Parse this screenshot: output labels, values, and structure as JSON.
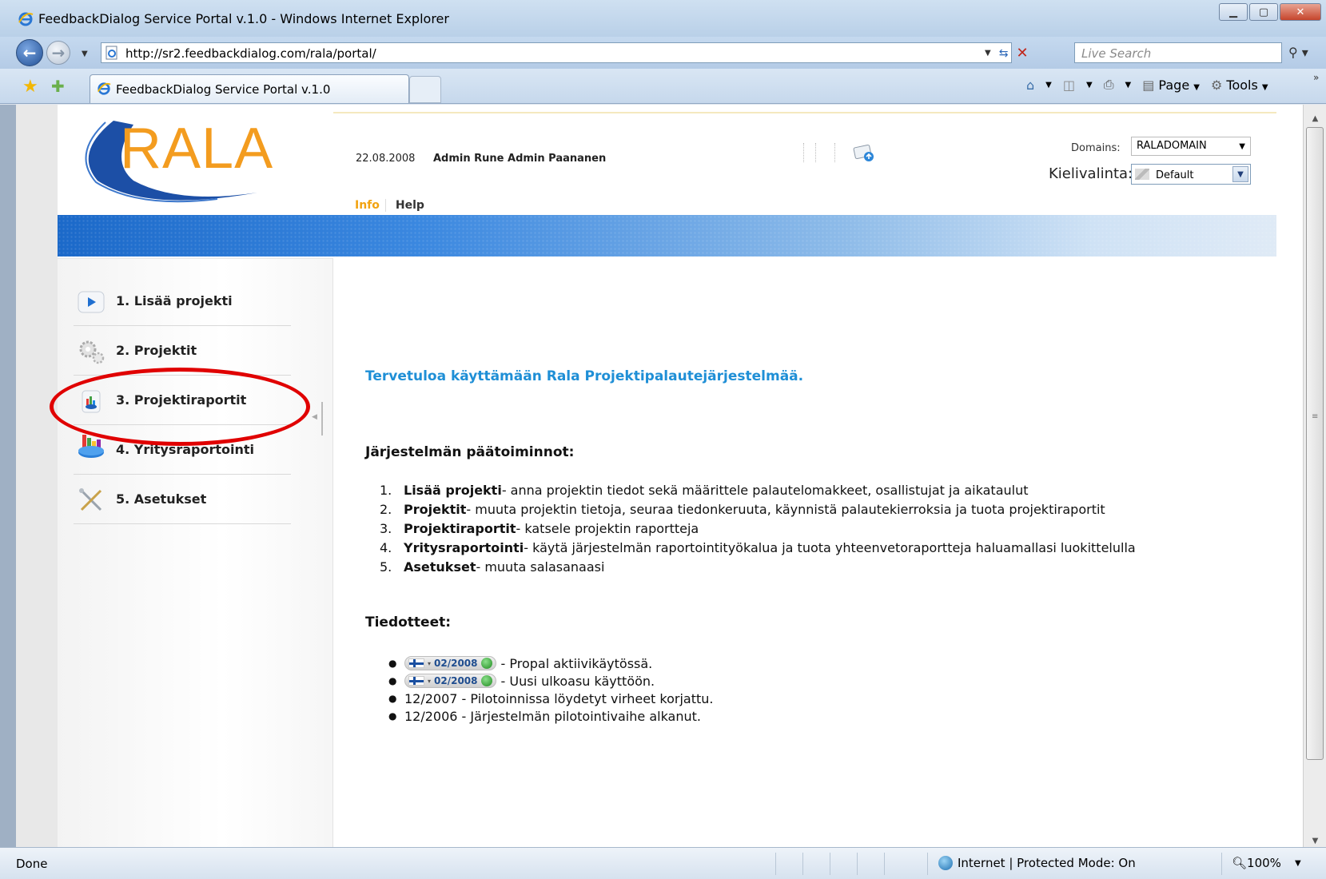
{
  "window": {
    "title": "FeedbackDialog Service Portal v.1.0 - Windows Internet Explorer",
    "url": "http://sr2.feedbackdialog.com/rala/portal/",
    "search_placeholder": "Live Search",
    "tab_title": "FeedbackDialog Service Portal v.1.0",
    "commands": {
      "page": "Page",
      "tools": "Tools"
    }
  },
  "header": {
    "logo_text": "RALA",
    "date": "22.08.2008",
    "user": "Admin Rune Admin Paananen",
    "domains_label": "Domains:",
    "domains_value": "RALADOMAIN",
    "language_label": "Kielivalinta:",
    "language_value": "Default",
    "nav": {
      "info": "Info",
      "help": "Help"
    }
  },
  "sidebar": {
    "items": [
      {
        "label": "1. Lisää projekti",
        "icon": "play-icon"
      },
      {
        "label": "2. Projektit",
        "icon": "gears-icon"
      },
      {
        "label": "3. Projektiraportit",
        "icon": "report-icon"
      },
      {
        "label": "4. Yritysraportointi",
        "icon": "chart-icon"
      },
      {
        "label": "5. Asetukset",
        "icon": "tools-icon"
      }
    ]
  },
  "main": {
    "welcome": "Tervetuloa käyttämään Rala Projektipalautejärjestelmää.",
    "features_heading": "Järjestelmän päätoiminnot:",
    "features": [
      {
        "num": "1.",
        "name": "Lisää projekti",
        "desc": "- anna projektin tiedot sekä määrittele palautelomakkeet, osallistujat ja aikataulut"
      },
      {
        "num": "2.",
        "name": "Projektit",
        "desc": "- muuta projektin tietoja, seuraa tiedonkeruuta, käynnistä palautekierroksia ja tuota projektiraportit"
      },
      {
        "num": "3.",
        "name": "Projektiraportit",
        "desc": "- katsele projektin raportteja"
      },
      {
        "num": "4.",
        "name": "Yritysraportointi",
        "desc": "- käytä järjestelmän raportointityökalua ja tuota yhteenvetoraportteja haluamallasi luokittelulla"
      },
      {
        "num": "5.",
        "name": "Asetukset",
        "desc": "- muuta salasanaasi"
      }
    ],
    "news_heading": "Tiedotteet:",
    "news": [
      {
        "badge": "02/2008",
        "text": "- Propal aktiivikäytössä."
      },
      {
        "badge": "02/2008",
        "text": "- Uusi ulkoasu käyttöön."
      },
      {
        "badge": "",
        "text": "12/2007 - Pilotoinnissa löydetyt virheet korjattu."
      },
      {
        "badge": "",
        "text": "12/2006 - Järjestelmän pilotointivaihe alkanut."
      }
    ]
  },
  "status": {
    "left": "Done",
    "zone": "Internet | Protected Mode: On",
    "zoom": "100%"
  },
  "colors": {
    "accent_blue": "#1f8fd6",
    "nav_active": "#f2a311",
    "highlight_ellipse": "#e00000",
    "logo_orange": "#f39c1f"
  }
}
